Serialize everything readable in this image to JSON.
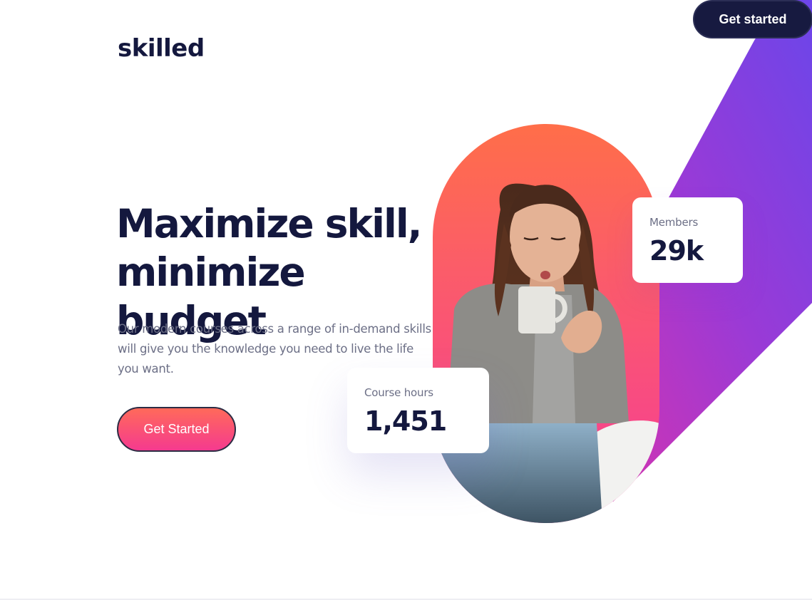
{
  "nav": {
    "cta_label": "Get started"
  },
  "brand": {
    "logo_text": "skilled"
  },
  "hero": {
    "headline_line1": "Maximize skill,",
    "headline_line2": "minimize budget",
    "description": "Our modern courses across a range of in-demand skills will give you the knowledge you need to live the life you want.",
    "cta_label": "Get Started"
  },
  "stats": {
    "members": {
      "label": "Members",
      "value": "29k"
    },
    "course_hours": {
      "label": "Course hours",
      "value": "1,451"
    }
  },
  "colors": {
    "navy": "#14183e",
    "coral": "#ff6e49",
    "pink": "#f63b98",
    "purple": "#6c42e6",
    "muted_text": "#6c6f86"
  }
}
